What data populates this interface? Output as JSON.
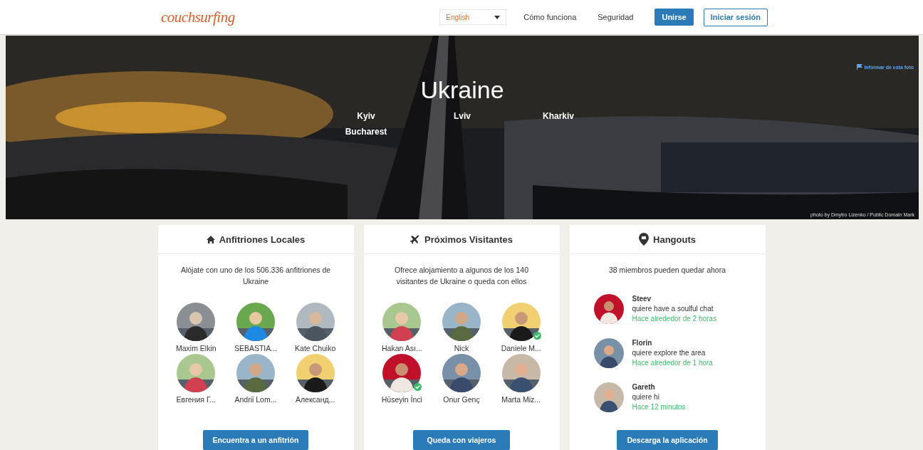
{
  "header": {
    "logo": "couchsurfing",
    "language": {
      "value": "English"
    },
    "nav_links": [
      "Cómo funciona",
      "Seguridad"
    ],
    "join_button": "Unirse",
    "login_button": "Iniciar sesión"
  },
  "hero": {
    "title": "Ukraine",
    "cities": [
      "Kyiv",
      "Lviv",
      "Kharkiv",
      "Bucharest"
    ],
    "report_link": "Informar de esta foto",
    "credit": "photo by Dmytro Lizenko / Public Domain Mark"
  },
  "cards": [
    {
      "kind": "members",
      "title": "Anfitriones Locales",
      "description": "Alójate con uno de los 506.336 anfitriones de Ukraine",
      "members": [
        {
          "name": "Maxim Elkin",
          "verified": false
        },
        {
          "name": "SEBASTIA...",
          "verified": false
        },
        {
          "name": "Kate Chuiko",
          "verified": false
        },
        {
          "name": "Евгения Г...",
          "verified": false
        },
        {
          "name": "Andrii Lom...",
          "verified": false
        },
        {
          "name": "Александ...",
          "verified": false
        }
      ],
      "button": "Encuentra a un anfitrión"
    },
    {
      "kind": "members",
      "title": "Próximos Visitantes",
      "description": "Ofrece alojamiento a algunos de los 140 visitantes de Ukraine o queda con ellos",
      "members": [
        {
          "name": "Hakan Ası...",
          "verified": false
        },
        {
          "name": "Nick",
          "verified": false
        },
        {
          "name": "Daniele M...",
          "verified": true
        },
        {
          "name": "Hüseyin İnci",
          "verified": true
        },
        {
          "name": "Onur Genç",
          "verified": false
        },
        {
          "name": "Marta Miz...",
          "verified": false
        }
      ],
      "button": "Queda con viajeros"
    },
    {
      "kind": "hangouts",
      "title": "Hangouts",
      "description": "38 miembros pueden quedar ahora",
      "hangouts": [
        {
          "name": "Steev",
          "activity": "quiere have a soulful chat",
          "time": "Hace alrededor de 2 horas"
        },
        {
          "name": "Florin",
          "activity": "quiere explore the area",
          "time": "Hace alrededor de 1 hora"
        },
        {
          "name": "Gareth",
          "activity": "quiere hi",
          "time": "Hace 12 minutos"
        }
      ],
      "button": "Descarga la aplicación"
    }
  ]
}
